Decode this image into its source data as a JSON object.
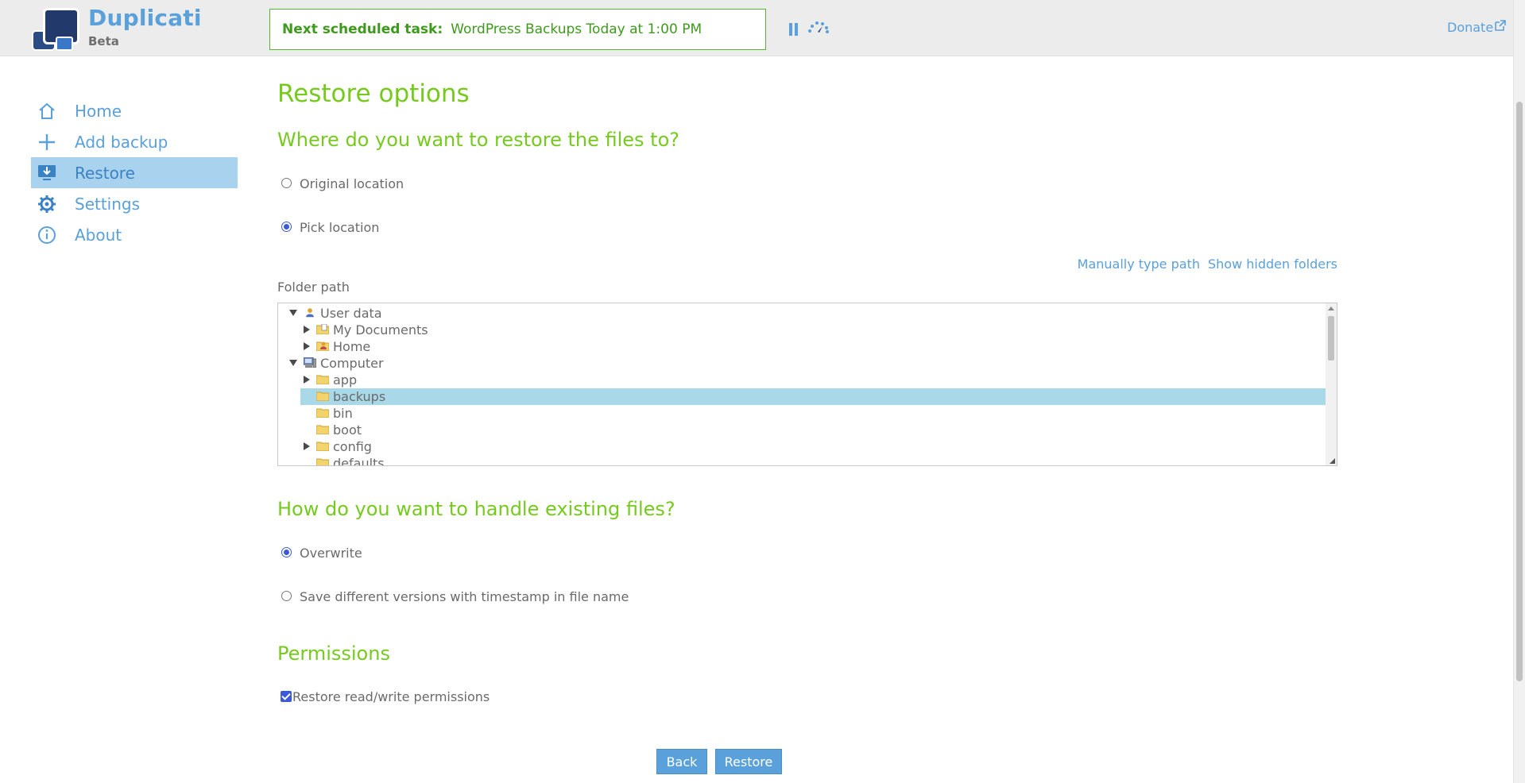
{
  "app": {
    "name": "Duplicati",
    "edition": "Beta"
  },
  "header": {
    "task_label": "Next scheduled task:",
    "task_text": "WordPress Backups Today at 1:00 PM",
    "pause_icon": "pause-icon",
    "throttle_icon": "throttle-speed-icon",
    "donate_label": "Donate",
    "donate_icon": "external-link-icon"
  },
  "sidebar": {
    "items": [
      {
        "label": "Home",
        "icon": "home-icon",
        "active": false
      },
      {
        "label": "Add backup",
        "icon": "plus-icon",
        "active": false
      },
      {
        "label": "Restore",
        "icon": "restore-monitor-icon",
        "active": true
      },
      {
        "label": "Settings",
        "icon": "gear-icon",
        "active": false
      },
      {
        "label": "About",
        "icon": "info-icon",
        "active": false
      }
    ]
  },
  "main": {
    "title": "Restore options",
    "destination": {
      "heading": "Where do you want to restore the files to?",
      "options": [
        {
          "label": "Original location",
          "checked": false
        },
        {
          "label": "Pick location",
          "checked": true
        }
      ],
      "manual_path_link": "Manually type path",
      "hidden_folders_link": "Show hidden folders",
      "folder_path_label": "Folder path",
      "tree": [
        {
          "label": "User data",
          "level": 0,
          "toggle": "expanded",
          "icon": "user-data-icon",
          "selected": false
        },
        {
          "label": "My Documents",
          "level": 1,
          "toggle": "collapsed",
          "icon": "documents-folder-icon",
          "selected": false
        },
        {
          "label": "Home",
          "level": 1,
          "toggle": "collapsed",
          "icon": "home-folder-icon",
          "selected": false
        },
        {
          "label": "Computer",
          "level": 0,
          "toggle": "expanded",
          "icon": "computer-icon",
          "selected": false
        },
        {
          "label": "app",
          "level": 1,
          "toggle": "collapsed",
          "icon": "folder-icon",
          "selected": false
        },
        {
          "label": "backups",
          "level": 1,
          "toggle": "none",
          "icon": "folder-icon",
          "selected": true
        },
        {
          "label": "bin",
          "level": 1,
          "toggle": "none",
          "icon": "folder-icon",
          "selected": false
        },
        {
          "label": "boot",
          "level": 1,
          "toggle": "none",
          "icon": "folder-icon",
          "selected": false
        },
        {
          "label": "config",
          "level": 1,
          "toggle": "collapsed",
          "icon": "folder-icon",
          "selected": false
        },
        {
          "label": "defaults",
          "level": 1,
          "toggle": "none",
          "icon": "folder-icon",
          "selected": false
        }
      ]
    },
    "existing": {
      "heading": "How do you want to handle existing files?",
      "options": [
        {
          "label": "Overwrite",
          "checked": true
        },
        {
          "label": "Save different versions with timestamp in file name",
          "checked": false
        }
      ]
    },
    "permissions": {
      "heading": "Permissions",
      "checkbox_label": "Restore read/write permissions",
      "checked": true
    },
    "buttons": {
      "back": "Back",
      "restore": "Restore"
    }
  },
  "colors": {
    "accent_blue": "#5aa0da",
    "heading_green": "#76ca1e",
    "task_green": "#3e9a1d",
    "active_nav_bg": "#a9d2ee",
    "selected_row_bg": "#a9d9e8"
  }
}
